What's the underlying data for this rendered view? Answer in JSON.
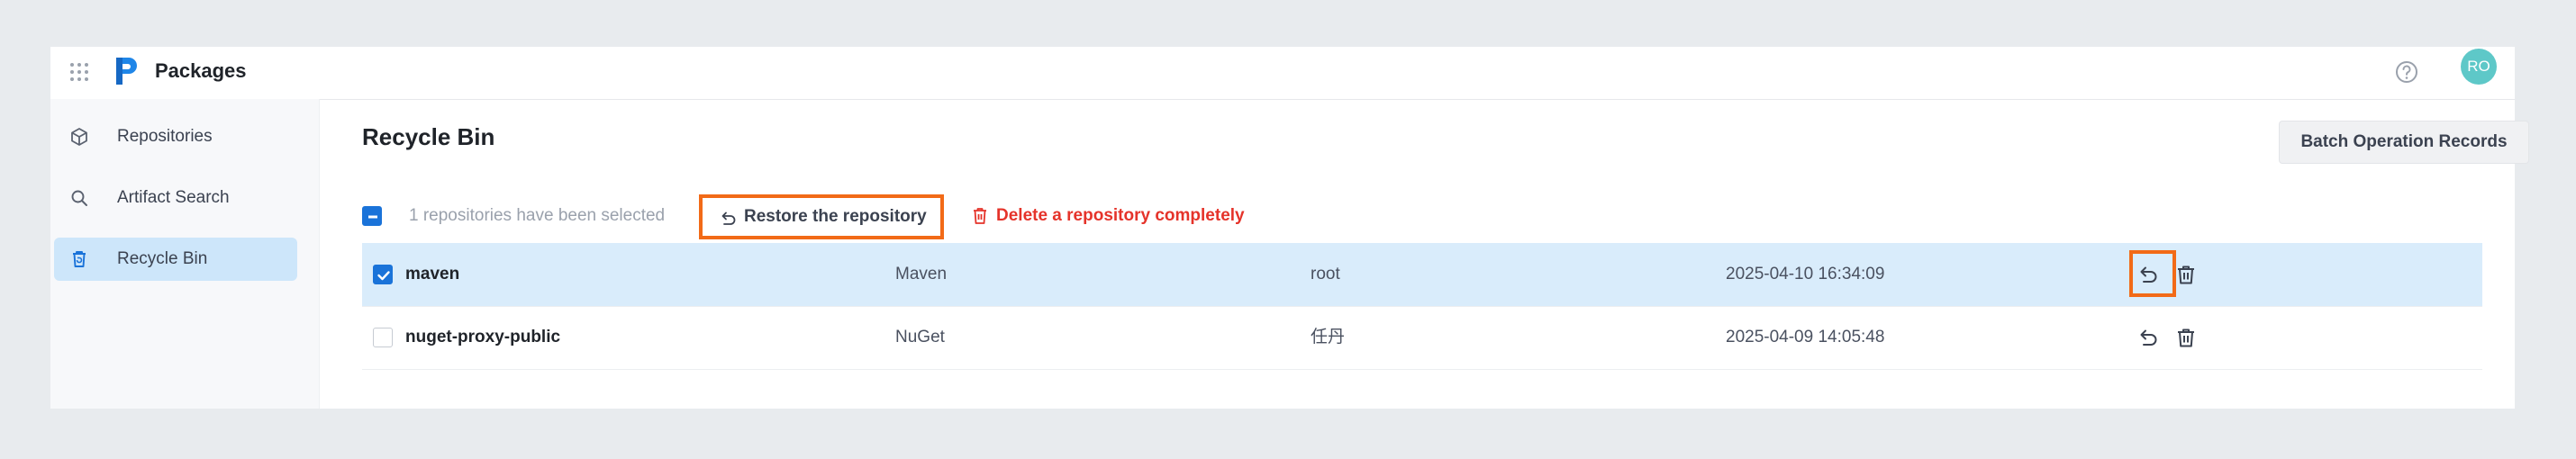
{
  "app": {
    "title": "Packages",
    "avatar_initials": "RO"
  },
  "sidebar": {
    "items": [
      {
        "label": "Repositories",
        "icon": "package-icon"
      },
      {
        "label": "Artifact Search",
        "icon": "search-icon"
      },
      {
        "label": "Recycle Bin",
        "icon": "recycle-bin-icon",
        "active": true
      }
    ]
  },
  "main": {
    "title": "Recycle Bin",
    "batch_button": "Batch Operation Records",
    "selection_text": "1 repositories have been selected",
    "restore_button": "Restore the repository",
    "delete_button": "Delete a repository completely"
  },
  "table": {
    "rows": [
      {
        "name": "maven",
        "type": "Maven",
        "user": "root",
        "date": "2025-04-10 16:34:09",
        "checked": true
      },
      {
        "name": "nuget-proxy-public",
        "type": "NuGet",
        "user": "任丹",
        "date": "2025-04-09 14:05:48",
        "checked": false
      }
    ]
  },
  "colors": {
    "accent": "#1a73d9",
    "highlight": "#f26a17",
    "danger": "#e5332a",
    "selected_row": "#d9ecfb",
    "active_nav": "#cde6fa",
    "avatar": "#5ec8c8"
  }
}
